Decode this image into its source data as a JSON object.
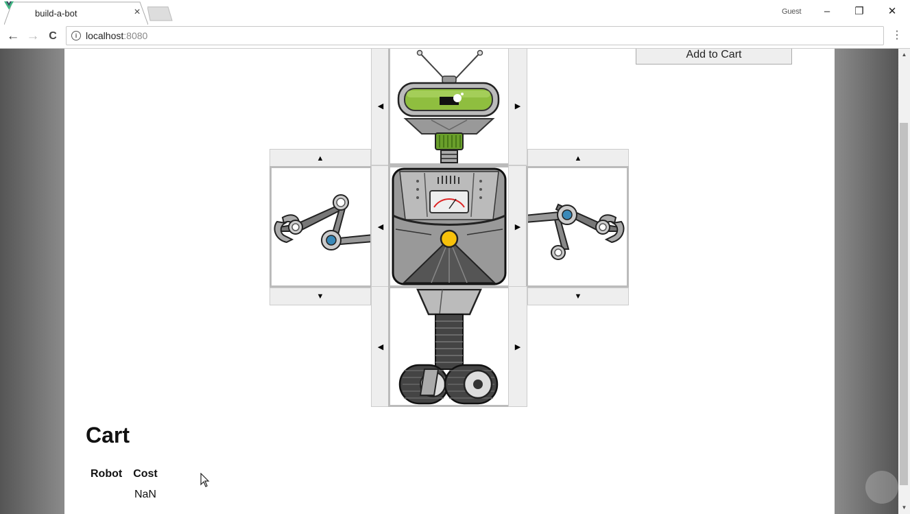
{
  "browser": {
    "tab_title": "build-a-bot",
    "tab_close": "×",
    "profile_label": "Guest",
    "window_buttons": {
      "minimize": "–",
      "restore": "❐",
      "close": "✕"
    },
    "nav": {
      "back": "←",
      "forward": "→",
      "reload": "C"
    },
    "url_host": "localhost",
    "url_port": ":8080",
    "menu": "⋮",
    "info_icon": "i"
  },
  "app": {
    "add_to_cart_label": "Add to Cart",
    "arrows": {
      "left": "◀",
      "right": "▶",
      "up": "▲",
      "down": "▼"
    },
    "parts": {
      "head": "robot-head-image",
      "left_arm": "robot-left-arm-image",
      "torso": "robot-torso-image",
      "right_arm": "robot-right-arm-image",
      "base": "robot-base-image"
    },
    "cart": {
      "title": "Cart",
      "columns": [
        "Robot",
        "Cost"
      ],
      "rows": [
        {
          "robot": "",
          "cost": "NaN"
        }
      ]
    }
  }
}
